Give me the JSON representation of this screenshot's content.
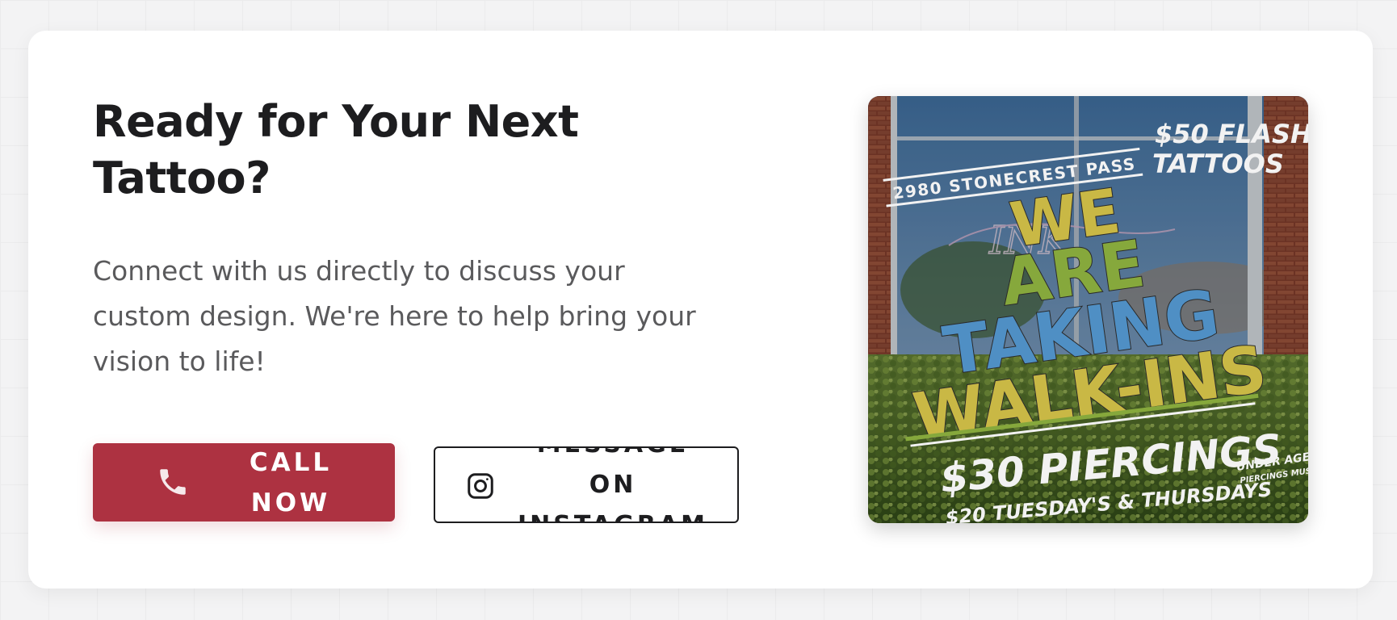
{
  "cta": {
    "heading": "Ready for Your Next Tattoo?",
    "description": "Connect with us directly to discuss your custom design. We're here to help bring your vision to life!",
    "call_button": {
      "label": "CALL NOW",
      "icon": "phone-icon"
    },
    "instagram_button": {
      "label": "MESSAGE ON INSTAGRAM",
      "icon": "instagram-icon"
    }
  },
  "promo": {
    "address": "2980 STONECREST PASS",
    "flash_line1": "$50 FLASH",
    "flash_line2": "TATTOOS",
    "headline_we": "WE",
    "headline_are": "ARE",
    "headline_taking": "TAKING",
    "headline_walkins": "WALK-INS",
    "piercings": "$30 PIERCINGS",
    "tuesday_deal": "$20 TUESDAY'S & THURSDAYS",
    "underage_line1": "UNDER AGE",
    "underage_line2": "PIERCINGS MUST",
    "colors": {
      "yellow": "#c9b845",
      "green": "#86a83c",
      "blue": "#4f8fc4",
      "white": "#f2f2f2"
    }
  },
  "colors": {
    "accent": "#ad3241",
    "text": "#1d1d1f",
    "muted": "#5a5a5c"
  }
}
